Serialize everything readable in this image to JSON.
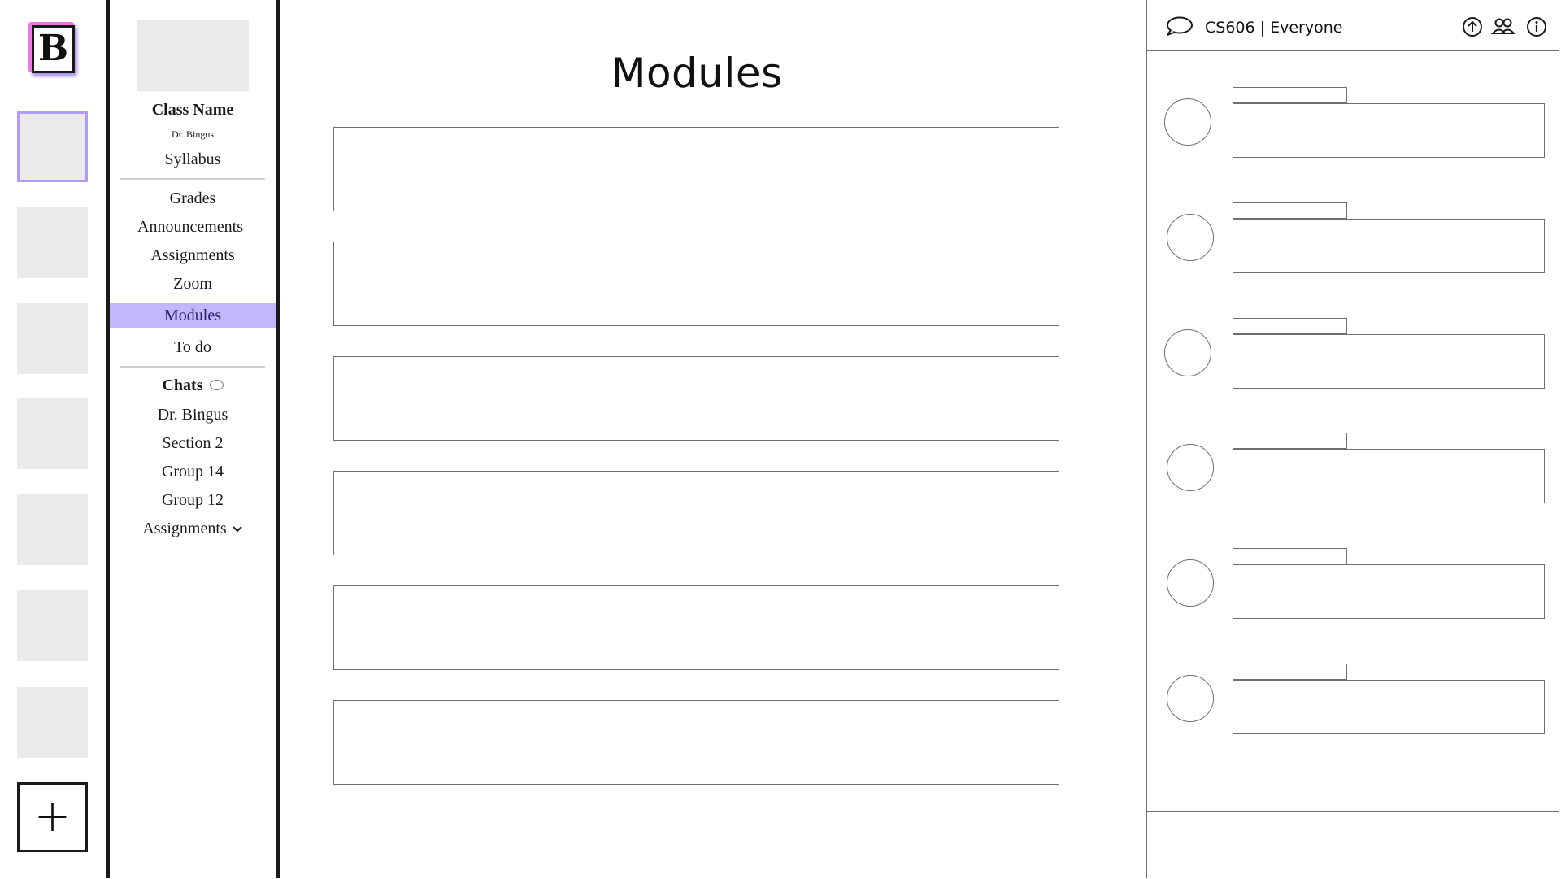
{
  "app": {
    "logo_letter": "B",
    "accent": "#c4b6fa",
    "brand_pink": "#ee77e6"
  },
  "rail": {
    "add_label": "+"
  },
  "class": {
    "name": "Class Name",
    "instructor": "Dr. Bingus",
    "syllabus": "Syllabus"
  },
  "nav": {
    "grades": "Grades",
    "announcements": "Announcements",
    "assignments": "Assignments",
    "zoom": "Zoom",
    "modules": "Modules",
    "todo": "To do"
  },
  "chats": {
    "heading": "Chats",
    "items": [
      "Dr. Bingus",
      "Section 2",
      "Group 14",
      "Group 12"
    ],
    "assignments": "Assignments"
  },
  "main": {
    "title": "Modules"
  },
  "chat_panel": {
    "title": "CS606 | Everyone"
  }
}
